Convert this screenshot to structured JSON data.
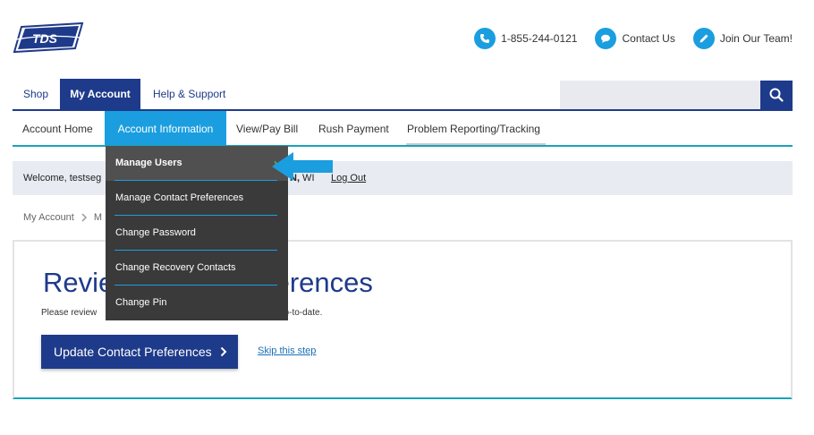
{
  "brand": {
    "logo_text": "TDS",
    "accent": "#1e3a8a",
    "accent_light": "#1a9ee0",
    "teal": "#1aa3b8"
  },
  "header_links": [
    {
      "label": "1-855-244-0121",
      "icon": "phone-icon"
    },
    {
      "label": "Contact Us",
      "icon": "chat-icon"
    },
    {
      "label": "Join Our Team!",
      "icon": "pencil-icon"
    }
  ],
  "top_nav": {
    "tabs": [
      {
        "label": "Shop"
      },
      {
        "label": "My Account",
        "active": true
      },
      {
        "label": "Help & Support"
      }
    ],
    "search_placeholder": ""
  },
  "sub_nav": {
    "items": [
      {
        "label": "Account Home"
      },
      {
        "label": "Account Information",
        "active": true
      },
      {
        "label": "View/Pay Bill"
      },
      {
        "label": "Rush Payment"
      },
      {
        "label": "Problem Reporting/Tracking"
      }
    ]
  },
  "dropdown": {
    "items": [
      {
        "label": "Manage Users",
        "hovered": true
      },
      {
        "label": "Manage Contact Preferences"
      },
      {
        "label": "Change Password"
      },
      {
        "label": "Change Recovery Contacts"
      },
      {
        "label": "Change Pin"
      }
    ],
    "chevron": "›"
  },
  "welcome": {
    "prefix": "Welcome, testseg",
    "location_bold": "N,",
    "location_rest": " WI",
    "logout_label": "Log Out"
  },
  "breadcrumb": {
    "first": "My Account",
    "second": "M"
  },
  "main": {
    "title_start": "Revie",
    "title_end": "ferences",
    "desc_start": "Please review",
    "desc_end": "up-to-date.",
    "update_button": "Update Contact Preferences",
    "skip_link": "Skip this step"
  }
}
